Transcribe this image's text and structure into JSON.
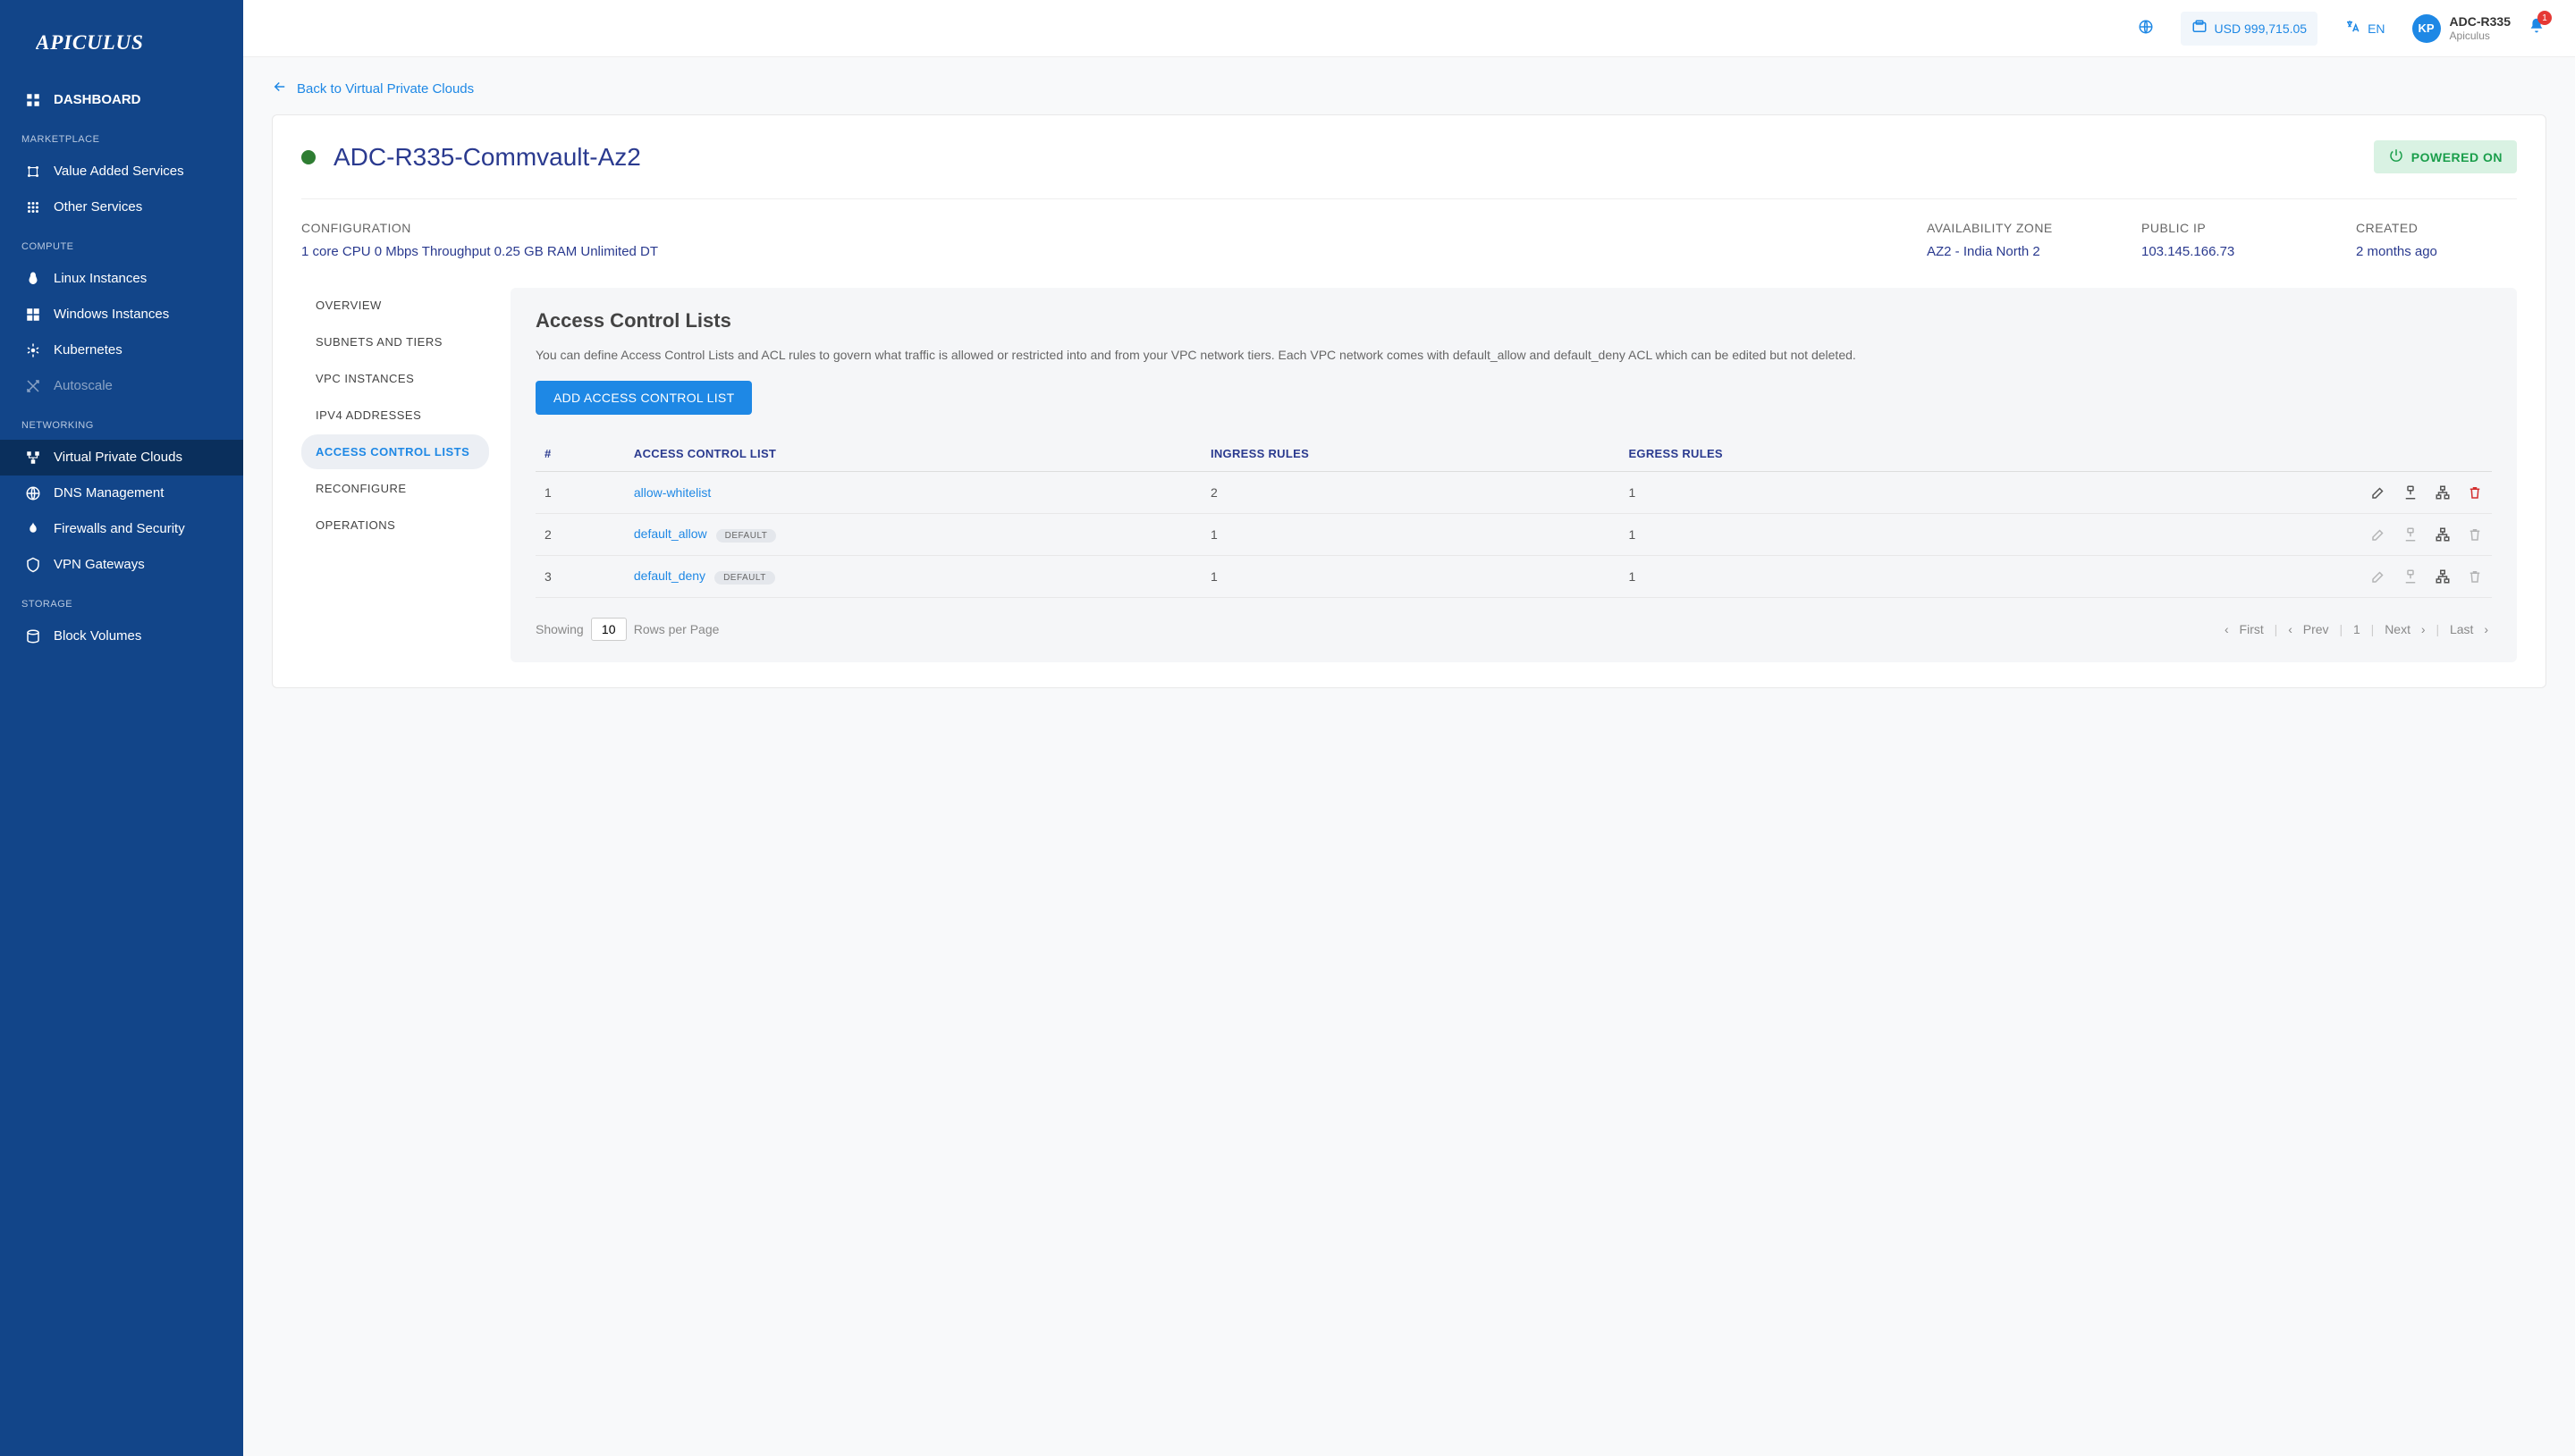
{
  "logo_text": "APICULUS",
  "topbar": {
    "balance": "USD 999,715.05",
    "lang_label": "EN",
    "avatar_initials": "KP",
    "user_name": "ADC-R335",
    "user_sub": "Apiculus",
    "notif_count": "1"
  },
  "sidebar": {
    "dashboard": "DASHBOARD",
    "sections": [
      {
        "header": "MARKETPLACE",
        "items": [
          {
            "label": "Value Added Services",
            "icon": "vas"
          },
          {
            "label": "Other Services",
            "icon": "grid"
          }
        ]
      },
      {
        "header": "COMPUTE",
        "items": [
          {
            "label": "Linux Instances",
            "icon": "linux"
          },
          {
            "label": "Windows Instances",
            "icon": "windows"
          },
          {
            "label": "Kubernetes",
            "icon": "k8s"
          },
          {
            "label": "Autoscale",
            "icon": "autoscale",
            "disabled": true
          }
        ]
      },
      {
        "header": "NETWORKING",
        "items": [
          {
            "label": "Virtual Private Clouds",
            "icon": "vpc",
            "active": true
          },
          {
            "label": "DNS Management",
            "icon": "dns"
          },
          {
            "label": "Firewalls and Security",
            "icon": "firewall"
          },
          {
            "label": "VPN Gateways",
            "icon": "vpn"
          }
        ]
      },
      {
        "header": "STORAGE",
        "items": [
          {
            "label": "Block Volumes",
            "icon": "block"
          }
        ]
      }
    ]
  },
  "back_link": "Back to Virtual Private Clouds",
  "vpc": {
    "name": "ADC-R335-Commvault-Az2",
    "power_label": "POWERED ON",
    "info": {
      "config_label": "CONFIGURATION",
      "config_value": "1 core CPU 0 Mbps Throughput 0.25 GB RAM Unlimited DT",
      "az_label": "AVAILABILITY ZONE",
      "az_value": "AZ2 - India North 2",
      "ip_label": "PUBLIC IP",
      "ip_value": "103.145.166.73",
      "created_label": "CREATED",
      "created_value": "2 months ago"
    }
  },
  "side_tabs": [
    "OVERVIEW",
    "SUBNETS AND TIERS",
    "VPC INSTANCES",
    "IPV4 ADDRESSES",
    "ACCESS CONTROL LISTS",
    "RECONFIGURE",
    "OPERATIONS"
  ],
  "side_tab_active": "ACCESS CONTROL LISTS",
  "panel": {
    "title": "Access Control Lists",
    "desc": "You can define Access Control Lists and ACL rules to govern what traffic is allowed or restricted into and from your VPC network tiers. Each VPC network comes with default_allow and default_deny ACL which can be edited but not deleted.",
    "add_btn": "ADD ACCESS CONTROL LIST",
    "columns": {
      "idx": "#",
      "name": "ACCESS CONTROL LIST",
      "ingress": "INGRESS RULES",
      "egress": "EGRESS RULES"
    },
    "rows": [
      {
        "idx": "1",
        "name": "allow-whitelist",
        "default": false,
        "ingress": "2",
        "egress": "1",
        "editable": true
      },
      {
        "idx": "2",
        "name": "default_allow",
        "default": true,
        "ingress": "1",
        "egress": "1",
        "editable": false
      },
      {
        "idx": "3",
        "name": "default_deny",
        "default": true,
        "ingress": "1",
        "egress": "1",
        "editable": false
      }
    ],
    "default_badge": "DEFAULT",
    "pagination": {
      "showing": "Showing",
      "rows_value": "10",
      "rows_label": "Rows per Page",
      "first": "First",
      "prev": "Prev",
      "page": "1",
      "next": "Next",
      "last": "Last"
    }
  }
}
